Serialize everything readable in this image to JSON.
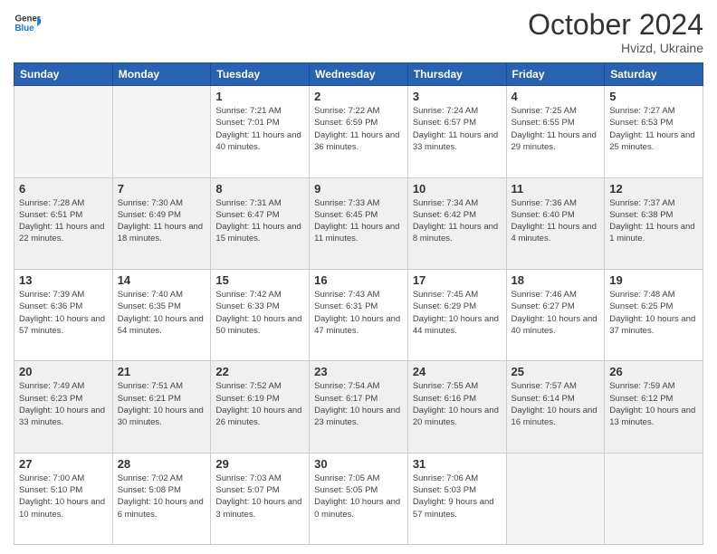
{
  "header": {
    "logo_general": "General",
    "logo_blue": "Blue",
    "main_title": "October 2024",
    "subtitle": "Hvizd, Ukraine"
  },
  "weekdays": [
    "Sunday",
    "Monday",
    "Tuesday",
    "Wednesday",
    "Thursday",
    "Friday",
    "Saturday"
  ],
  "weeks": [
    {
      "shaded": false,
      "days": [
        {
          "num": "",
          "info": ""
        },
        {
          "num": "",
          "info": ""
        },
        {
          "num": "1",
          "info": "Sunrise: 7:21 AM\nSunset: 7:01 PM\nDaylight: 11 hours and 40 minutes."
        },
        {
          "num": "2",
          "info": "Sunrise: 7:22 AM\nSunset: 6:59 PM\nDaylight: 11 hours and 36 minutes."
        },
        {
          "num": "3",
          "info": "Sunrise: 7:24 AM\nSunset: 6:57 PM\nDaylight: 11 hours and 33 minutes."
        },
        {
          "num": "4",
          "info": "Sunrise: 7:25 AM\nSunset: 6:55 PM\nDaylight: 11 hours and 29 minutes."
        },
        {
          "num": "5",
          "info": "Sunrise: 7:27 AM\nSunset: 6:53 PM\nDaylight: 11 hours and 25 minutes."
        }
      ]
    },
    {
      "shaded": true,
      "days": [
        {
          "num": "6",
          "info": "Sunrise: 7:28 AM\nSunset: 6:51 PM\nDaylight: 11 hours and 22 minutes."
        },
        {
          "num": "7",
          "info": "Sunrise: 7:30 AM\nSunset: 6:49 PM\nDaylight: 11 hours and 18 minutes."
        },
        {
          "num": "8",
          "info": "Sunrise: 7:31 AM\nSunset: 6:47 PM\nDaylight: 11 hours and 15 minutes."
        },
        {
          "num": "9",
          "info": "Sunrise: 7:33 AM\nSunset: 6:45 PM\nDaylight: 11 hours and 11 minutes."
        },
        {
          "num": "10",
          "info": "Sunrise: 7:34 AM\nSunset: 6:42 PM\nDaylight: 11 hours and 8 minutes."
        },
        {
          "num": "11",
          "info": "Sunrise: 7:36 AM\nSunset: 6:40 PM\nDaylight: 11 hours and 4 minutes."
        },
        {
          "num": "12",
          "info": "Sunrise: 7:37 AM\nSunset: 6:38 PM\nDaylight: 11 hours and 1 minute."
        }
      ]
    },
    {
      "shaded": false,
      "days": [
        {
          "num": "13",
          "info": "Sunrise: 7:39 AM\nSunset: 6:36 PM\nDaylight: 10 hours and 57 minutes."
        },
        {
          "num": "14",
          "info": "Sunrise: 7:40 AM\nSunset: 6:35 PM\nDaylight: 10 hours and 54 minutes."
        },
        {
          "num": "15",
          "info": "Sunrise: 7:42 AM\nSunset: 6:33 PM\nDaylight: 10 hours and 50 minutes."
        },
        {
          "num": "16",
          "info": "Sunrise: 7:43 AM\nSunset: 6:31 PM\nDaylight: 10 hours and 47 minutes."
        },
        {
          "num": "17",
          "info": "Sunrise: 7:45 AM\nSunset: 6:29 PM\nDaylight: 10 hours and 44 minutes."
        },
        {
          "num": "18",
          "info": "Sunrise: 7:46 AM\nSunset: 6:27 PM\nDaylight: 10 hours and 40 minutes."
        },
        {
          "num": "19",
          "info": "Sunrise: 7:48 AM\nSunset: 6:25 PM\nDaylight: 10 hours and 37 minutes."
        }
      ]
    },
    {
      "shaded": true,
      "days": [
        {
          "num": "20",
          "info": "Sunrise: 7:49 AM\nSunset: 6:23 PM\nDaylight: 10 hours and 33 minutes."
        },
        {
          "num": "21",
          "info": "Sunrise: 7:51 AM\nSunset: 6:21 PM\nDaylight: 10 hours and 30 minutes."
        },
        {
          "num": "22",
          "info": "Sunrise: 7:52 AM\nSunset: 6:19 PM\nDaylight: 10 hours and 26 minutes."
        },
        {
          "num": "23",
          "info": "Sunrise: 7:54 AM\nSunset: 6:17 PM\nDaylight: 10 hours and 23 minutes."
        },
        {
          "num": "24",
          "info": "Sunrise: 7:55 AM\nSunset: 6:16 PM\nDaylight: 10 hours and 20 minutes."
        },
        {
          "num": "25",
          "info": "Sunrise: 7:57 AM\nSunset: 6:14 PM\nDaylight: 10 hours and 16 minutes."
        },
        {
          "num": "26",
          "info": "Sunrise: 7:59 AM\nSunset: 6:12 PM\nDaylight: 10 hours and 13 minutes."
        }
      ]
    },
    {
      "shaded": false,
      "days": [
        {
          "num": "27",
          "info": "Sunrise: 7:00 AM\nSunset: 5:10 PM\nDaylight: 10 hours and 10 minutes."
        },
        {
          "num": "28",
          "info": "Sunrise: 7:02 AM\nSunset: 5:08 PM\nDaylight: 10 hours and 6 minutes."
        },
        {
          "num": "29",
          "info": "Sunrise: 7:03 AM\nSunset: 5:07 PM\nDaylight: 10 hours and 3 minutes."
        },
        {
          "num": "30",
          "info": "Sunrise: 7:05 AM\nSunset: 5:05 PM\nDaylight: 10 hours and 0 minutes."
        },
        {
          "num": "31",
          "info": "Sunrise: 7:06 AM\nSunset: 5:03 PM\nDaylight: 9 hours and 57 minutes."
        },
        {
          "num": "",
          "info": ""
        },
        {
          "num": "",
          "info": ""
        }
      ]
    }
  ]
}
